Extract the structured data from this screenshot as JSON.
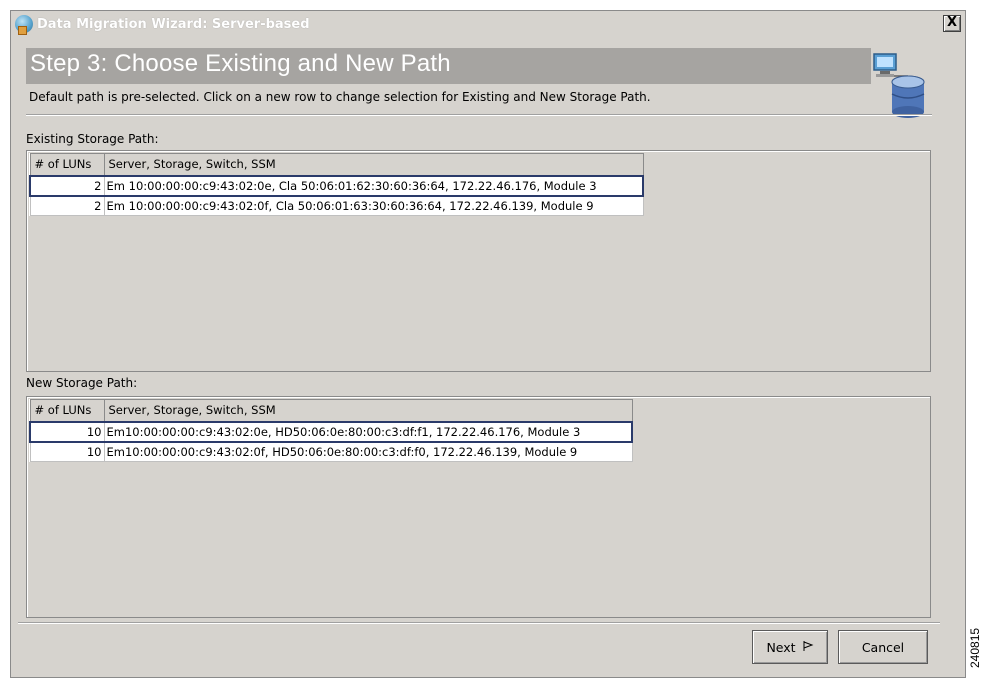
{
  "window": {
    "title": "Data Migration Wizard: Server-based",
    "close_label": "X"
  },
  "header": {
    "step_title": "Step 3: Choose Existing and New Path",
    "description": "Default path is pre-selected. Click on a new row to change selection for Existing and New Storage Path."
  },
  "existing": {
    "label": "Existing Storage Path:",
    "columns": [
      "# of LUNs",
      "Server, Storage, Switch, SSM"
    ],
    "rows": [
      {
        "luns": "2",
        "path": "Em 10:00:00:00:c9:43:02:0e, Cla 50:06:01:62:30:60:36:64, 172.22.46.176, Module 3",
        "selected": true
      },
      {
        "luns": "2",
        "path": "Em 10:00:00:00:c9:43:02:0f, Cla 50:06:01:63:30:60:36:64, 172.22.46.139, Module 9",
        "selected": false
      }
    ]
  },
  "new": {
    "label": "New Storage Path:",
    "columns": [
      "# of LUNs",
      "Server, Storage, Switch, SSM"
    ],
    "rows": [
      {
        "luns": "10",
        "path": "Em10:00:00:00:c9:43:02:0e, HD50:06:0e:80:00:c3:df:f1, 172.22.46.176, Module 3",
        "selected": true
      },
      {
        "luns": "10",
        "path": "Em10:00:00:00:c9:43:02:0f, HD50:06:0e:80:00:c3:df:f0, 172.22.46.139, Module 9",
        "selected": false
      }
    ]
  },
  "buttons": {
    "next_label": "Next",
    "cancel_label": "Cancel"
  },
  "icons": {
    "app": "app-globe-icon",
    "wizard": "server-database-icon",
    "next": "flag-icon"
  },
  "figure_id": "240815"
}
